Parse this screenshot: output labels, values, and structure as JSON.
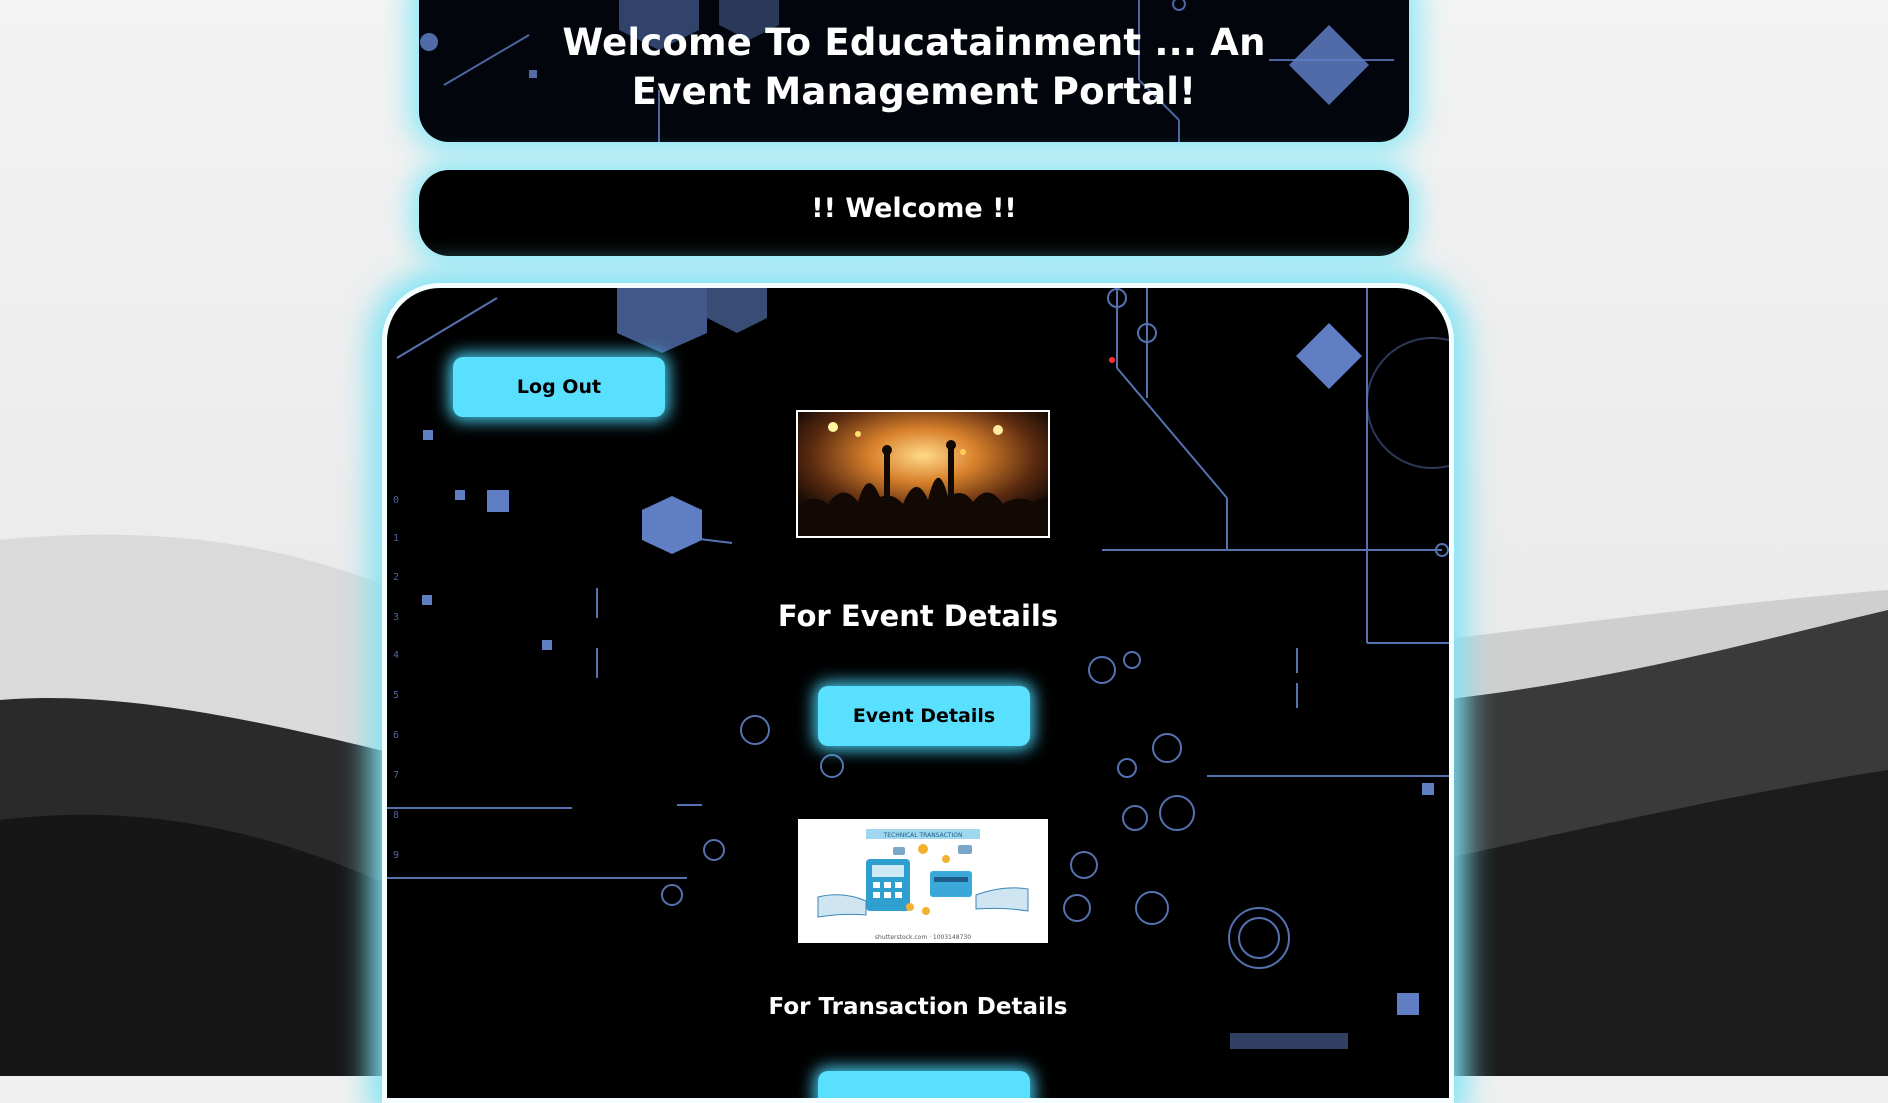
{
  "header": {
    "title": "Welcome To Educatainment ... An Event Management Portal!"
  },
  "welcome_bar": {
    "text": "!! Welcome !!"
  },
  "panel": {
    "logout_label": "Log Out",
    "event_section": {
      "heading": "For Event Details",
      "button_label": "Event Details",
      "image": "concert-crowd-image"
    },
    "transaction_section": {
      "heading": "For Transaction Details",
      "button_label": "",
      "image": "transaction-illustration",
      "image_caption": "TECHNICAL TRANSACTION",
      "image_footer": "shutterstock.com · 1003148730"
    }
  },
  "colors": {
    "accent": "#5ae0ff",
    "glow": "#8ee9f7",
    "panel_bg": "#000000",
    "circuit": "#5f7ec4"
  }
}
